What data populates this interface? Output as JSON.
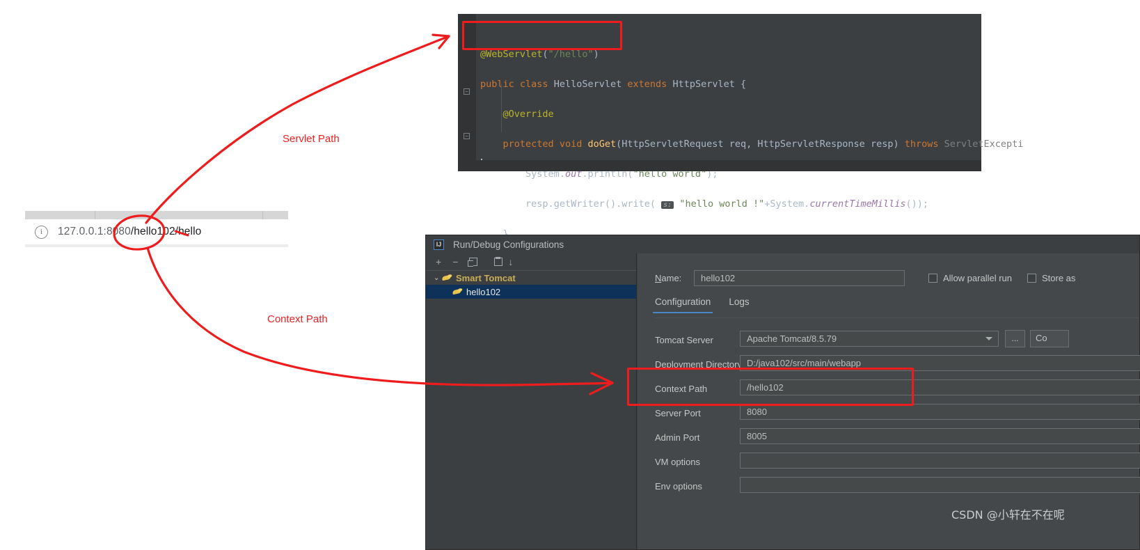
{
  "code_editor": {
    "name": "java-code-editor",
    "lines": [
      {
        "id": "line-annotation",
        "text": "@WebServlet(\"/hello\")"
      },
      {
        "id": "line-class-decl",
        "text": "public class HelloServlet extends HttpServlet {"
      },
      {
        "id": "line-override",
        "text": "    @Override"
      },
      {
        "id": "line-doget",
        "text": "    protected void doGet(HttpServletRequest req, HttpServletResponse resp) throws ServletExcepti"
      },
      {
        "id": "line-println",
        "text": "        System.out.println(\"hello world\");"
      },
      {
        "id": "line-write",
        "text": "        resp.getWriter().write( s: \"hello world !\"+System.currentTimeMillis());"
      },
      {
        "id": "line-close-method",
        "text": "    }"
      },
      {
        "id": "line-close-class",
        "text": "}"
      }
    ],
    "tokens": {
      "annotation": "@WebServlet",
      "annotation_arg": "\"/hello\"",
      "kw_public": "public",
      "kw_class": "class",
      "class_name": "HelloServlet",
      "kw_extends": "extends",
      "super_class": "HttpServlet",
      "override": "@Override",
      "kw_protected": "protected",
      "kw_void": "void",
      "method_doget": "doGet",
      "param_req_type": "HttpServletRequest",
      "param_req": "req",
      "param_resp_type": "HttpServletResponse",
      "param_resp": "resp",
      "kw_throws": "throws",
      "throws_type": "ServletExcepti",
      "sys": "System",
      "out": "out",
      "println": "println",
      "str_hello_world": "\"hello world\"",
      "getwriter": "getWriter",
      "write": "write",
      "param_hint": "s:",
      "str_hello_world_bang": "\"hello world !\"",
      "currenttimemillis": "currentTimeMillis"
    }
  },
  "browser": {
    "name": "browser-url-bar",
    "info_icon": "info-icon",
    "url_host": "127.0.0.1:8080",
    "url_context": "/hello102",
    "url_servlet": "/hello",
    "url_full": "127.0.0.1:8080/hello102/hello"
  },
  "dialog": {
    "title": "Run/Debug Configurations",
    "app_icon": "IJ",
    "toolbar": [
      {
        "name": "add-configuration-button",
        "glyph": "+"
      },
      {
        "name": "remove-configuration-button",
        "glyph": "−"
      },
      {
        "name": "copy-configuration-button",
        "glyph": ""
      },
      {
        "name": "new-folder-button",
        "glyph": ""
      },
      {
        "name": "sort-configurations-button",
        "glyph": "↓"
      }
    ],
    "tree": {
      "group_label": "Smart Tomcat",
      "child_label": "hello102",
      "chevron": "⌄"
    },
    "name_field": {
      "label": "Name:",
      "label_mnemonic": "N",
      "value": "hello102"
    },
    "checkboxes": [
      {
        "name": "allow-parallel-run-checkbox",
        "label": "Allow parallel run",
        "checked": false
      },
      {
        "name": "store-as-checkbox",
        "label": "Store as",
        "checked": false
      }
    ],
    "tabs": [
      {
        "name": "tab-configuration",
        "label": "Configuration",
        "active": true
      },
      {
        "name": "tab-logs",
        "label": "Logs",
        "active": false
      }
    ],
    "fields": [
      {
        "name": "tomcat-server",
        "label": "Tomcat Server",
        "value": "Apache Tomcat/8.5.79",
        "type": "combo"
      },
      {
        "name": "deployment-directory",
        "label": "Deployment Directory",
        "value": "D:/java102/src/main/webapp",
        "type": "text"
      },
      {
        "name": "context-path",
        "label": "Context Path",
        "value": "/hello102",
        "type": "text"
      },
      {
        "name": "server-port",
        "label": "Server Port",
        "value": "8080",
        "type": "text"
      },
      {
        "name": "admin-port",
        "label": "Admin Port",
        "value": "8005",
        "type": "text"
      },
      {
        "name": "vm-options",
        "label": "VM options",
        "value": "",
        "type": "text"
      },
      {
        "name": "env-options",
        "label": "Env options",
        "value": "",
        "type": "text"
      }
    ],
    "buttons": {
      "ellipsis": "...",
      "configure": "Co"
    }
  },
  "annotations": {
    "servlet_path_label": "Servlet Path",
    "context_path_label": "Context Path",
    "accent_red": "#ee1c1c"
  },
  "watermark": {
    "text": "CSDN @小轩在不在呢"
  }
}
